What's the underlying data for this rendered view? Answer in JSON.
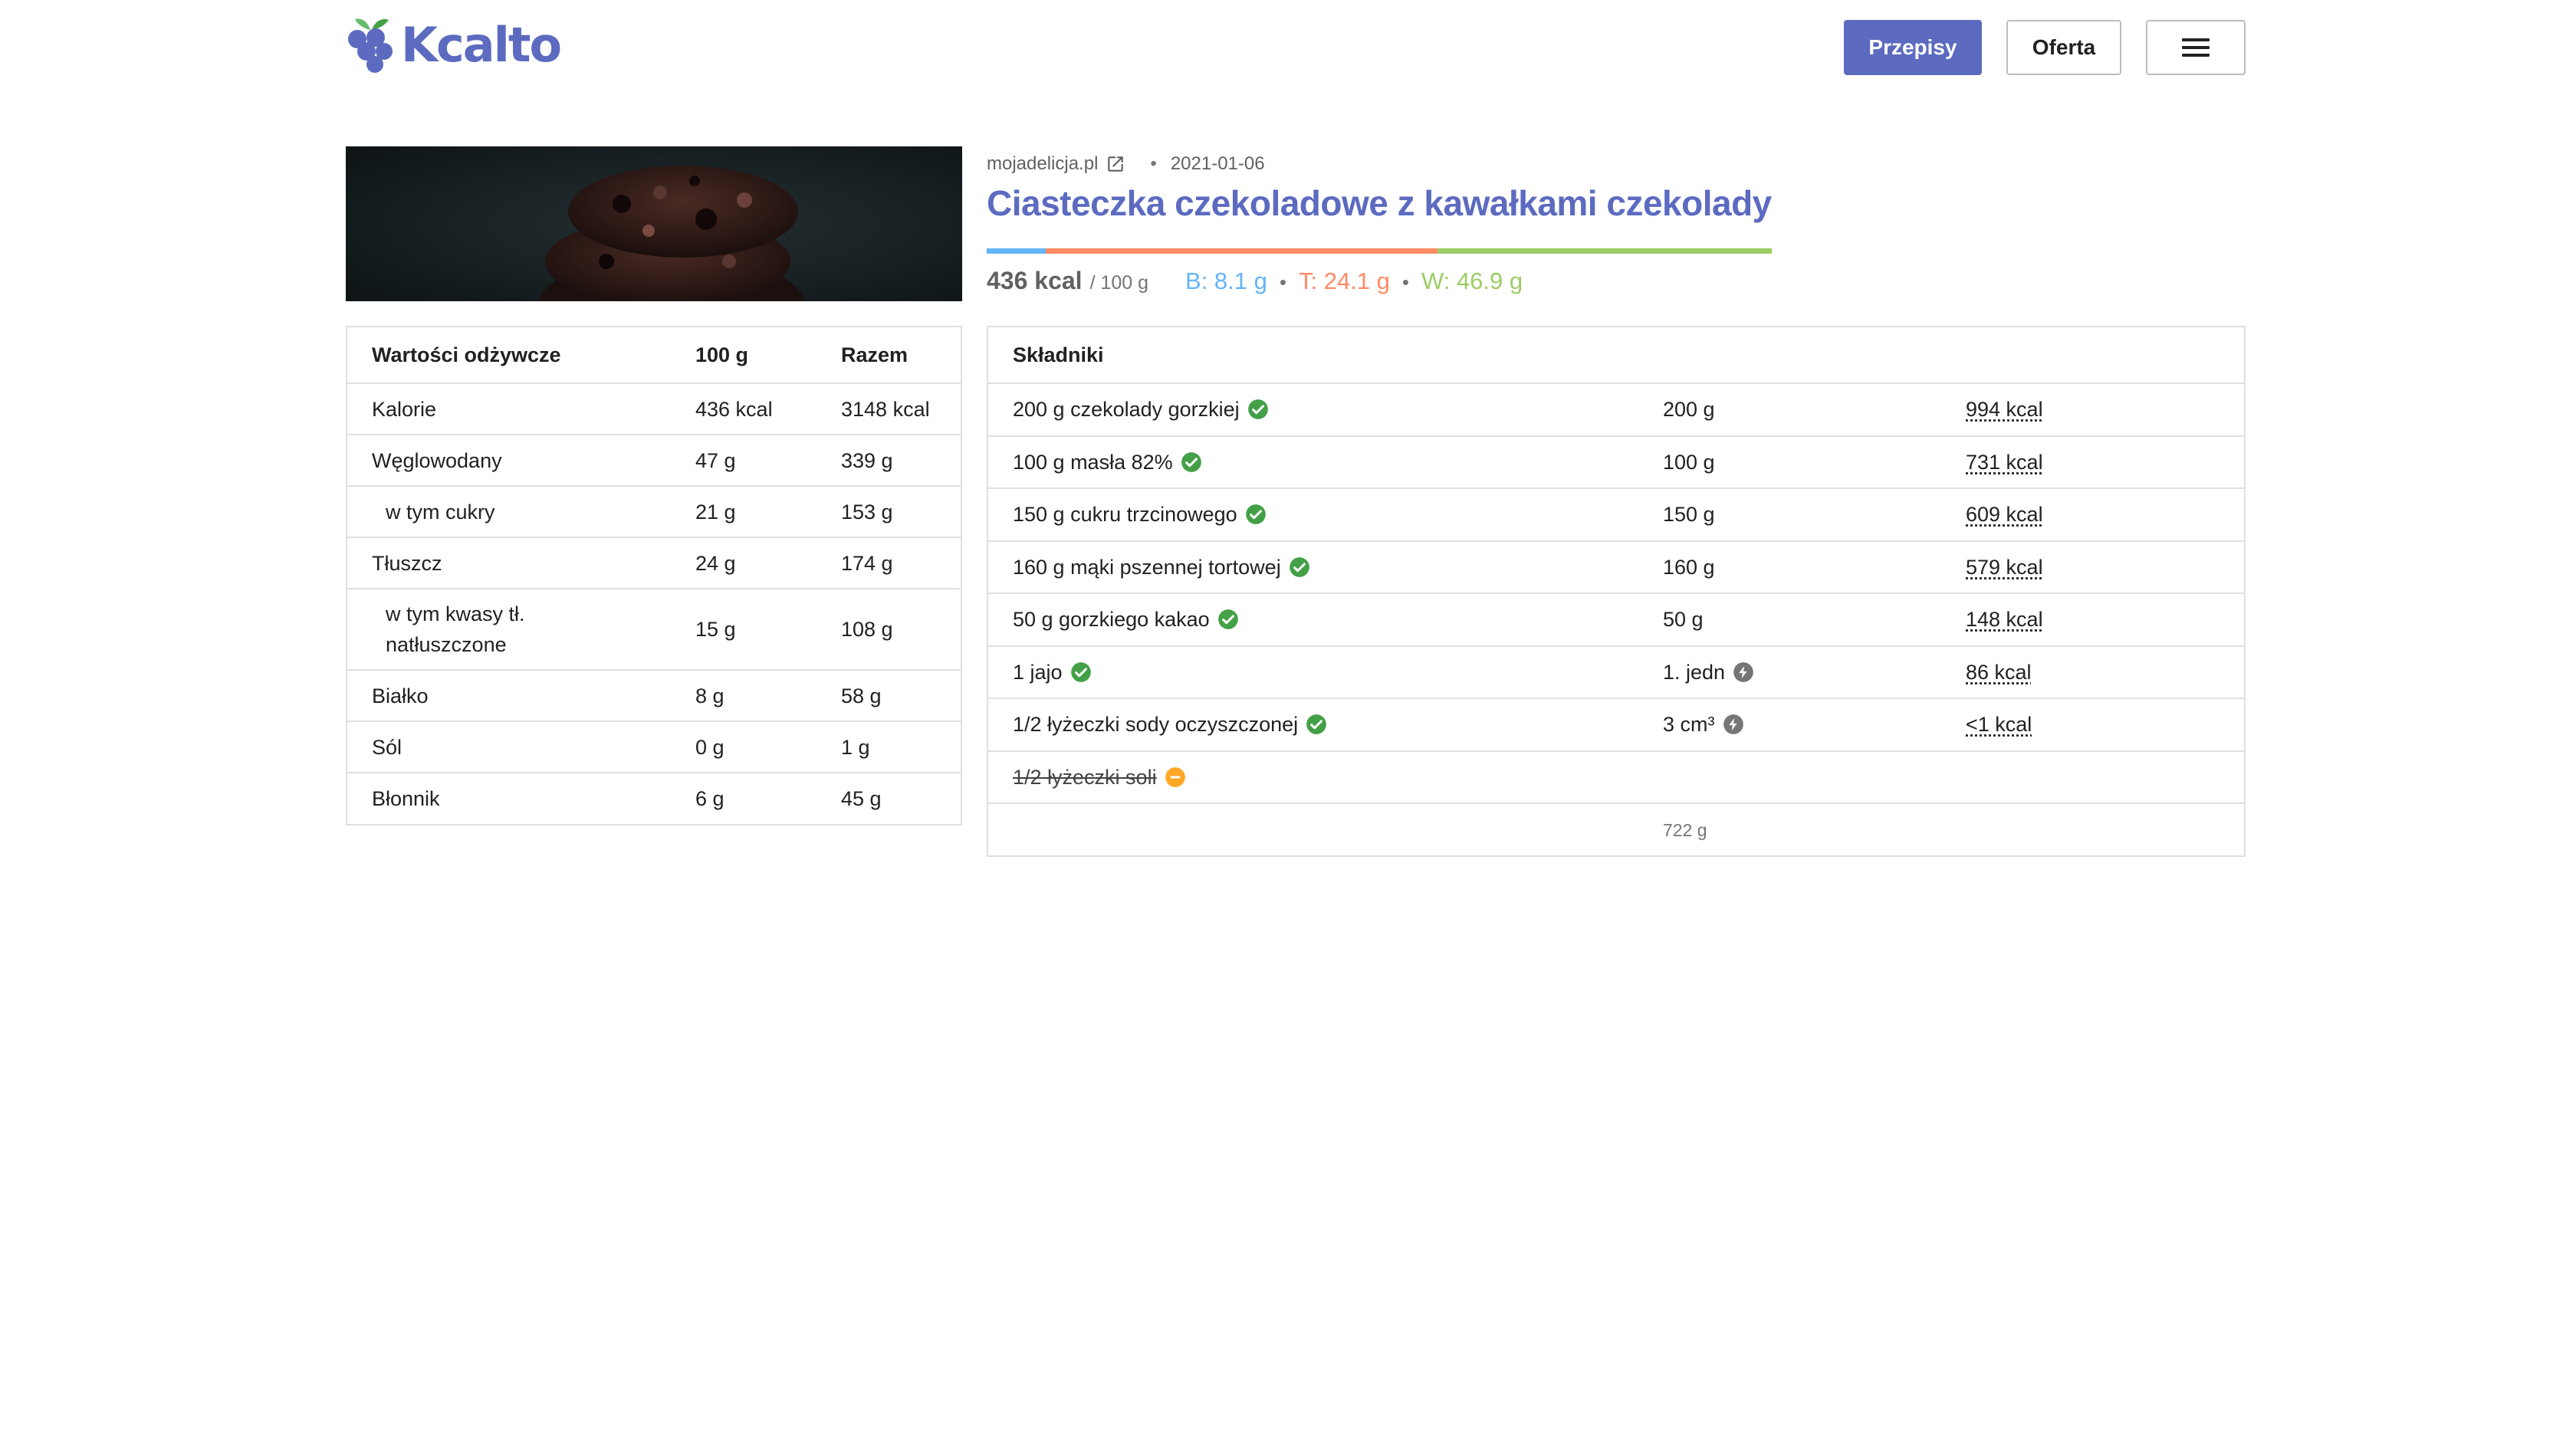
{
  "header": {
    "logo_text": "Kcalto",
    "nav": {
      "recipes": "Przepisy",
      "offer": "Oferta"
    }
  },
  "recipe": {
    "source": "mojadelicja.pl",
    "date": "2021-01-06",
    "title": "Ciasteczka czekoladowe z kawałkami czekolady",
    "kcal": "436 kcal",
    "per": "/ 100 g",
    "protein": "B: 8.1 g",
    "fat": "T: 24.1 g",
    "carbs": "W: 46.9 g",
    "macro_share": {
      "protein": 0.075,
      "fat": 0.499,
      "carbs": 0.426
    }
  },
  "colors": {
    "brand": "#5c6bc0",
    "protein": "#64b5f6",
    "fat": "#ff8a65",
    "carbs": "#9ccc65",
    "ok": "#43a047",
    "warn": "#ffa726",
    "neutral": "#757575"
  },
  "nutrition": {
    "headers": [
      "Wartości odżywcze",
      "100 g",
      "Razem"
    ],
    "rows": [
      {
        "name": "Kalorie",
        "per100": "436 kcal",
        "total": "3148 kcal",
        "indent": false
      },
      {
        "name": "Węglowodany",
        "per100": "47 g",
        "total": "339 g",
        "indent": false
      },
      {
        "name": "w tym cukry",
        "per100": "21 g",
        "total": "153 g",
        "indent": true
      },
      {
        "name": "Tłuszcz",
        "per100": "24 g",
        "total": "174 g",
        "indent": false
      },
      {
        "name": "w tym kwasy tł. natłuszczone",
        "per100": "15 g",
        "total": "108 g",
        "indent": true
      },
      {
        "name": "Białko",
        "per100": "8 g",
        "total": "58 g",
        "indent": false
      },
      {
        "name": "Sól",
        "per100": "0 g",
        "total": "1 g",
        "indent": false
      },
      {
        "name": "Błonnik",
        "per100": "6 g",
        "total": "45 g",
        "indent": false
      }
    ]
  },
  "ingredients": {
    "header": "Składniki",
    "rows": [
      {
        "name": "200 g czekolady gorzkiej",
        "amount": "200 g",
        "kcal": "994 kcal",
        "status": "ok-icon",
        "amount_icon": ""
      },
      {
        "name": "100 g masła 82%",
        "amount": "100 g",
        "kcal": "731 kcal",
        "status": "ok-icon",
        "amount_icon": ""
      },
      {
        "name": "150 g cukru trzcinowego",
        "amount": "150 g",
        "kcal": "609 kcal",
        "status": "ok-icon",
        "amount_icon": ""
      },
      {
        "name": "160 g mąki pszennej tortowej",
        "amount": "160 g",
        "kcal": "579 kcal",
        "status": "ok-icon",
        "amount_icon": ""
      },
      {
        "name": "50 g gorzkiego kakao",
        "amount": "50 g",
        "kcal": "148 kcal",
        "status": "ok-icon",
        "amount_icon": ""
      },
      {
        "name": "1 jajo",
        "amount": "1. jedn",
        "kcal": "86 kcal",
        "status": "ok-icon",
        "amount_icon": "bolt-icon"
      },
      {
        "name": "1/2 łyżeczki sody oczyszczonej",
        "amount": "3 cm³",
        "kcal": "<1 kcal",
        "status": "ok-icon",
        "amount_icon": "bolt-icon"
      },
      {
        "name": "1/2 łyżeczki soli",
        "amount": "",
        "kcal": "",
        "status": "minus-icon",
        "amount_icon": "",
        "struck": true
      }
    ],
    "total": "722 g"
  }
}
